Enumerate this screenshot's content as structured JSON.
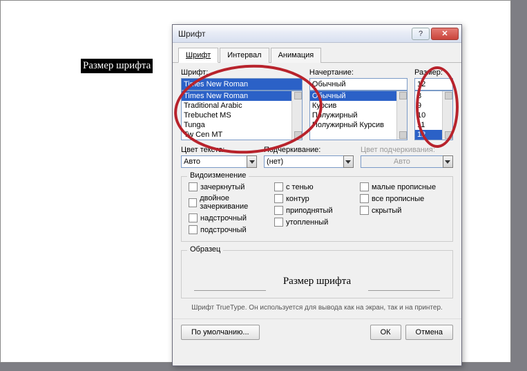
{
  "document": {
    "selected_text": "Размер шрифта"
  },
  "dialog": {
    "title": "Шрифт",
    "tabs": {
      "font": "Шрифт",
      "spacing": "Интервал",
      "animation": "Анимация"
    },
    "font_section": {
      "label": "Шрифт:",
      "value": "Times New Roman",
      "list": [
        "Times New Roman",
        "Traditional Arabic",
        "Trebuchet MS",
        "Tunga",
        "Tw Cen MT"
      ]
    },
    "style_section": {
      "label": "Начертание:",
      "value": "Обычный",
      "list": [
        "Обычный",
        "Курсив",
        "Полужирный",
        "Полужирный Курсив"
      ]
    },
    "size_section": {
      "label": "Размер:",
      "value": "12",
      "list": [
        "8",
        "9",
        "10",
        "11",
        "12"
      ]
    },
    "color": {
      "label": "Цвет текста:",
      "value": "Авто"
    },
    "underline": {
      "label": "Подчеркивание:",
      "value": "(нет)"
    },
    "underline_color": {
      "label": "Цвет подчеркивания:",
      "value": "Авто"
    },
    "effects": {
      "title": "Видоизменение",
      "col1": [
        "зачеркнутый",
        "двойное зачеркивание",
        "надстрочный",
        "подстрочный"
      ],
      "col2": [
        "с тенью",
        "контур",
        "приподнятый",
        "утопленный"
      ],
      "col3": [
        "малые прописные",
        "все прописные",
        "скрытый"
      ]
    },
    "preview": {
      "title": "Образец",
      "text": "Размер шрифта"
    },
    "hint": "Шрифт TrueType. Он используется для вывода как на экран, так и на принтер.",
    "buttons": {
      "default": "По умолчанию...",
      "ok": "ОК",
      "cancel": "Отмена"
    }
  }
}
